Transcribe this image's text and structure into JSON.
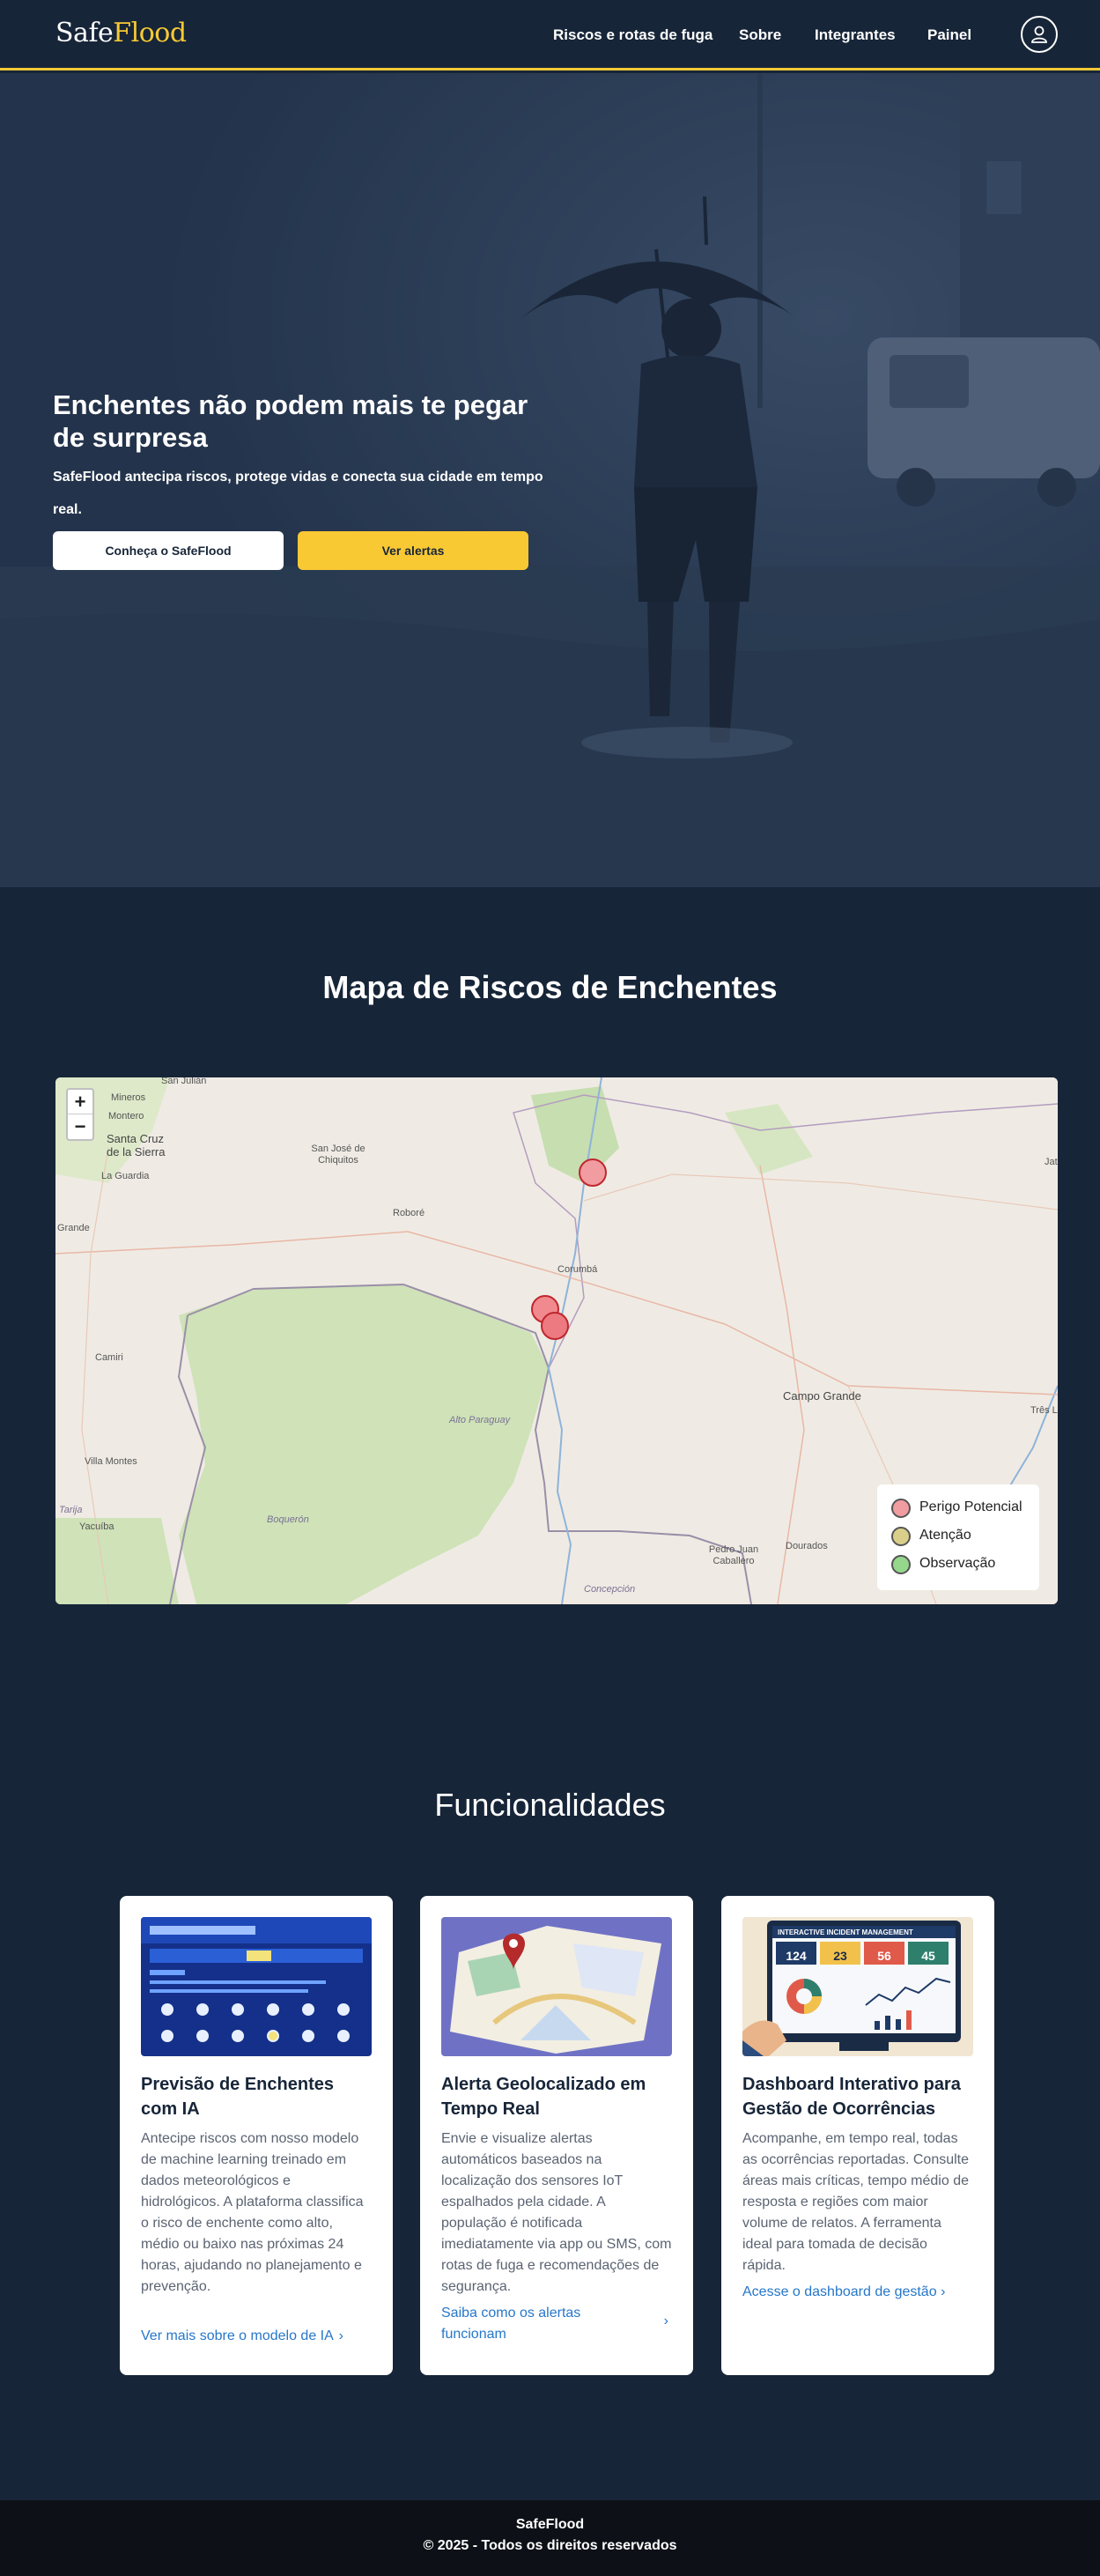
{
  "header": {
    "logo_part1": "Safe",
    "logo_part2": "Flood",
    "nav": [
      {
        "label": "Riscos e rotas de fuga"
      },
      {
        "label": "Sobre"
      },
      {
        "label": "Integrantes"
      },
      {
        "label": "Painel"
      }
    ],
    "user_icon": "user-icon"
  },
  "hero": {
    "title": "Enchentes não podem mais te pegar de surpresa",
    "subtitle": "SafeFlood antecipa riscos, protege vidas e conecta sua cidade em tempo real.",
    "primary_button": "Conheça o SafeFlood",
    "secondary_button": "Ver alertas"
  },
  "map_section": {
    "title": "Mapa de Riscos de Enchentes",
    "zoom_in": "+",
    "zoom_out": "−",
    "place_labels": [
      "San Julián",
      "Mineros",
      "Montero",
      "Santa Cruz de la Sierra",
      "La Guardia",
      "Grande",
      "San José de Chiquitos",
      "Roboré",
      "Corumbá",
      "Camiri",
      "Villa Montes",
      "Yacuíba",
      "Tarija",
      "Boquerón",
      "Alto Paraguay",
      "Campo Grande",
      "Pedro Juan Caballero",
      "Dourados",
      "Concepción",
      "Três L",
      "Jata"
    ],
    "legend": [
      {
        "label": "Perigo Potencial",
        "color": "#f19ca0"
      },
      {
        "label": "Atenção",
        "color": "#d9cf8a"
      },
      {
        "label": "Observação",
        "color": "#95d78b"
      }
    ],
    "marker_color": "#f08a8f"
  },
  "features": {
    "title": "Funcionalidades",
    "cards": [
      {
        "title": "Previsão de Enchentes com IA",
        "text": "Antecipe riscos com nosso modelo de machine learning treinado em dados meteorológicos e hidrológicos. A plataforma classifica o risco de enchente como alto, médio ou baixo nas próximas 24 horas, ajudando no planejamento e prevenção.",
        "link": "Ver mais sobre o modelo de IA",
        "chevron": "›"
      },
      {
        "title": "Alerta Geolocalizado em Tempo Real",
        "text": "Envie e visualize alertas automáticos baseados na localização dos sensores IoT espalhados pela cidade. A população é notificada imediatamente via app ou SMS, com rotas de fuga e recomendações de segurança.",
        "link": "Saiba como os alertas funcionam",
        "chevron": "›"
      },
      {
        "title": "Dashboard Interativo para Gestão de Ocorrências",
        "text": "Acompanhe, em tempo real, todas as ocorrências reportadas. Consulte áreas mais críticas, tempo médio de resposta e regiões com maior volume de relatos. A ferramenta ideal para tomada de decisão rápida.",
        "link": "Acesse o dashboard de gestão",
        "chevron": "›"
      }
    ],
    "dashboard_image_text": {
      "heading": "INTERACTIVE INCIDENT MANAGEMENT",
      "stat1_label": "TOTAL INCIDENTS",
      "stat1_value": "124",
      "stat2_label": "IN PROGRESS",
      "stat2_value": "23",
      "stat3_label": "PENDING",
      "stat3_value": "56",
      "stat4_label": "RESOLVED",
      "stat4_value": "45"
    }
  },
  "footer": {
    "brand": "SafeFlood",
    "copyright": "© 2025 - Todos os direitos reservados"
  }
}
